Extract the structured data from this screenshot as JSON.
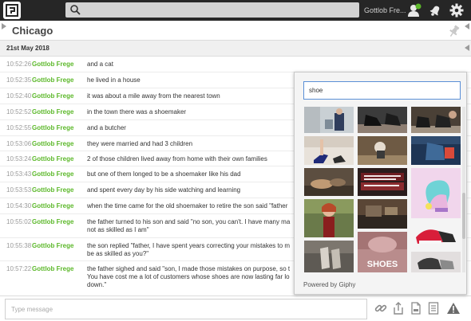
{
  "topbar": {
    "search_placeholder": "",
    "user_name": "Gottlob Fre...",
    "icons": [
      "app-logo-icon",
      "search-icon",
      "user-status-icon",
      "bell-icon",
      "gear-icon"
    ]
  },
  "room": {
    "name": "Chicago"
  },
  "date_header": "21st May 2018",
  "messages": [
    {
      "time": "10:52:26",
      "user": "Gottlob Frege",
      "text": "and a cat"
    },
    {
      "time": "10:52:35",
      "user": "Gottlob Frege",
      "text": "he lived in a house"
    },
    {
      "time": "10:52:40",
      "user": "Gottlob Frege",
      "text": "it was about a mile away from the nearest town"
    },
    {
      "time": "10:52:52",
      "user": "Gottlob Frege",
      "text": "in the town there was a shoemaker"
    },
    {
      "time": "10:52:55",
      "user": "Gottlob Frege",
      "text": "and a butcher"
    },
    {
      "time": "10:53:06",
      "user": "Gottlob Frege",
      "text": "they were married and had 3 children"
    },
    {
      "time": "10:53:24",
      "user": "Gottlob Frege",
      "text": "2 of those children lived away from home with their own families"
    },
    {
      "time": "10:53:43",
      "user": "Gottlob Frege",
      "text": "but one of them longed to be a shoemaker like his dad"
    },
    {
      "time": "10:53:53",
      "user": "Gottlob Frege",
      "text": "and spent every day by his side watching and learning"
    },
    {
      "time": "10:54:30",
      "user": "Gottlob Frege",
      "text": "when the time came for the old shoemaker to retire the son said \"father"
    },
    {
      "time": "10:55:02",
      "user": "Gottlob Frege",
      "text": "the father turned to his son and said \"no son, you can't. I have many ma not as skilled as I am\""
    },
    {
      "time": "10:55:38",
      "user": "Gottlob Frege",
      "text": "the son replied \"father, I have spent years correcting your mistakes to m be as skilled as you?\""
    },
    {
      "time": "10:57:22",
      "user": "Gottlob Frege",
      "text": "the father sighed and said \"son, I made those mistakes on purpose, so t You have cost me a lot of customers whose shoes are now lasting far lo down.\""
    }
  ],
  "composer": {
    "placeholder": "Type message",
    "icons": [
      "link-icon",
      "share-icon",
      "file-icon",
      "notes-icon",
      "warning-icon"
    ]
  },
  "giphy": {
    "query": "shoe",
    "overlay_text": "SHOES",
    "powered_by": "Powered by Giphy"
  },
  "colors": {
    "topbar": "#262626",
    "username_green": "#5cb82a",
    "accent_blue": "#5a8fd6"
  }
}
